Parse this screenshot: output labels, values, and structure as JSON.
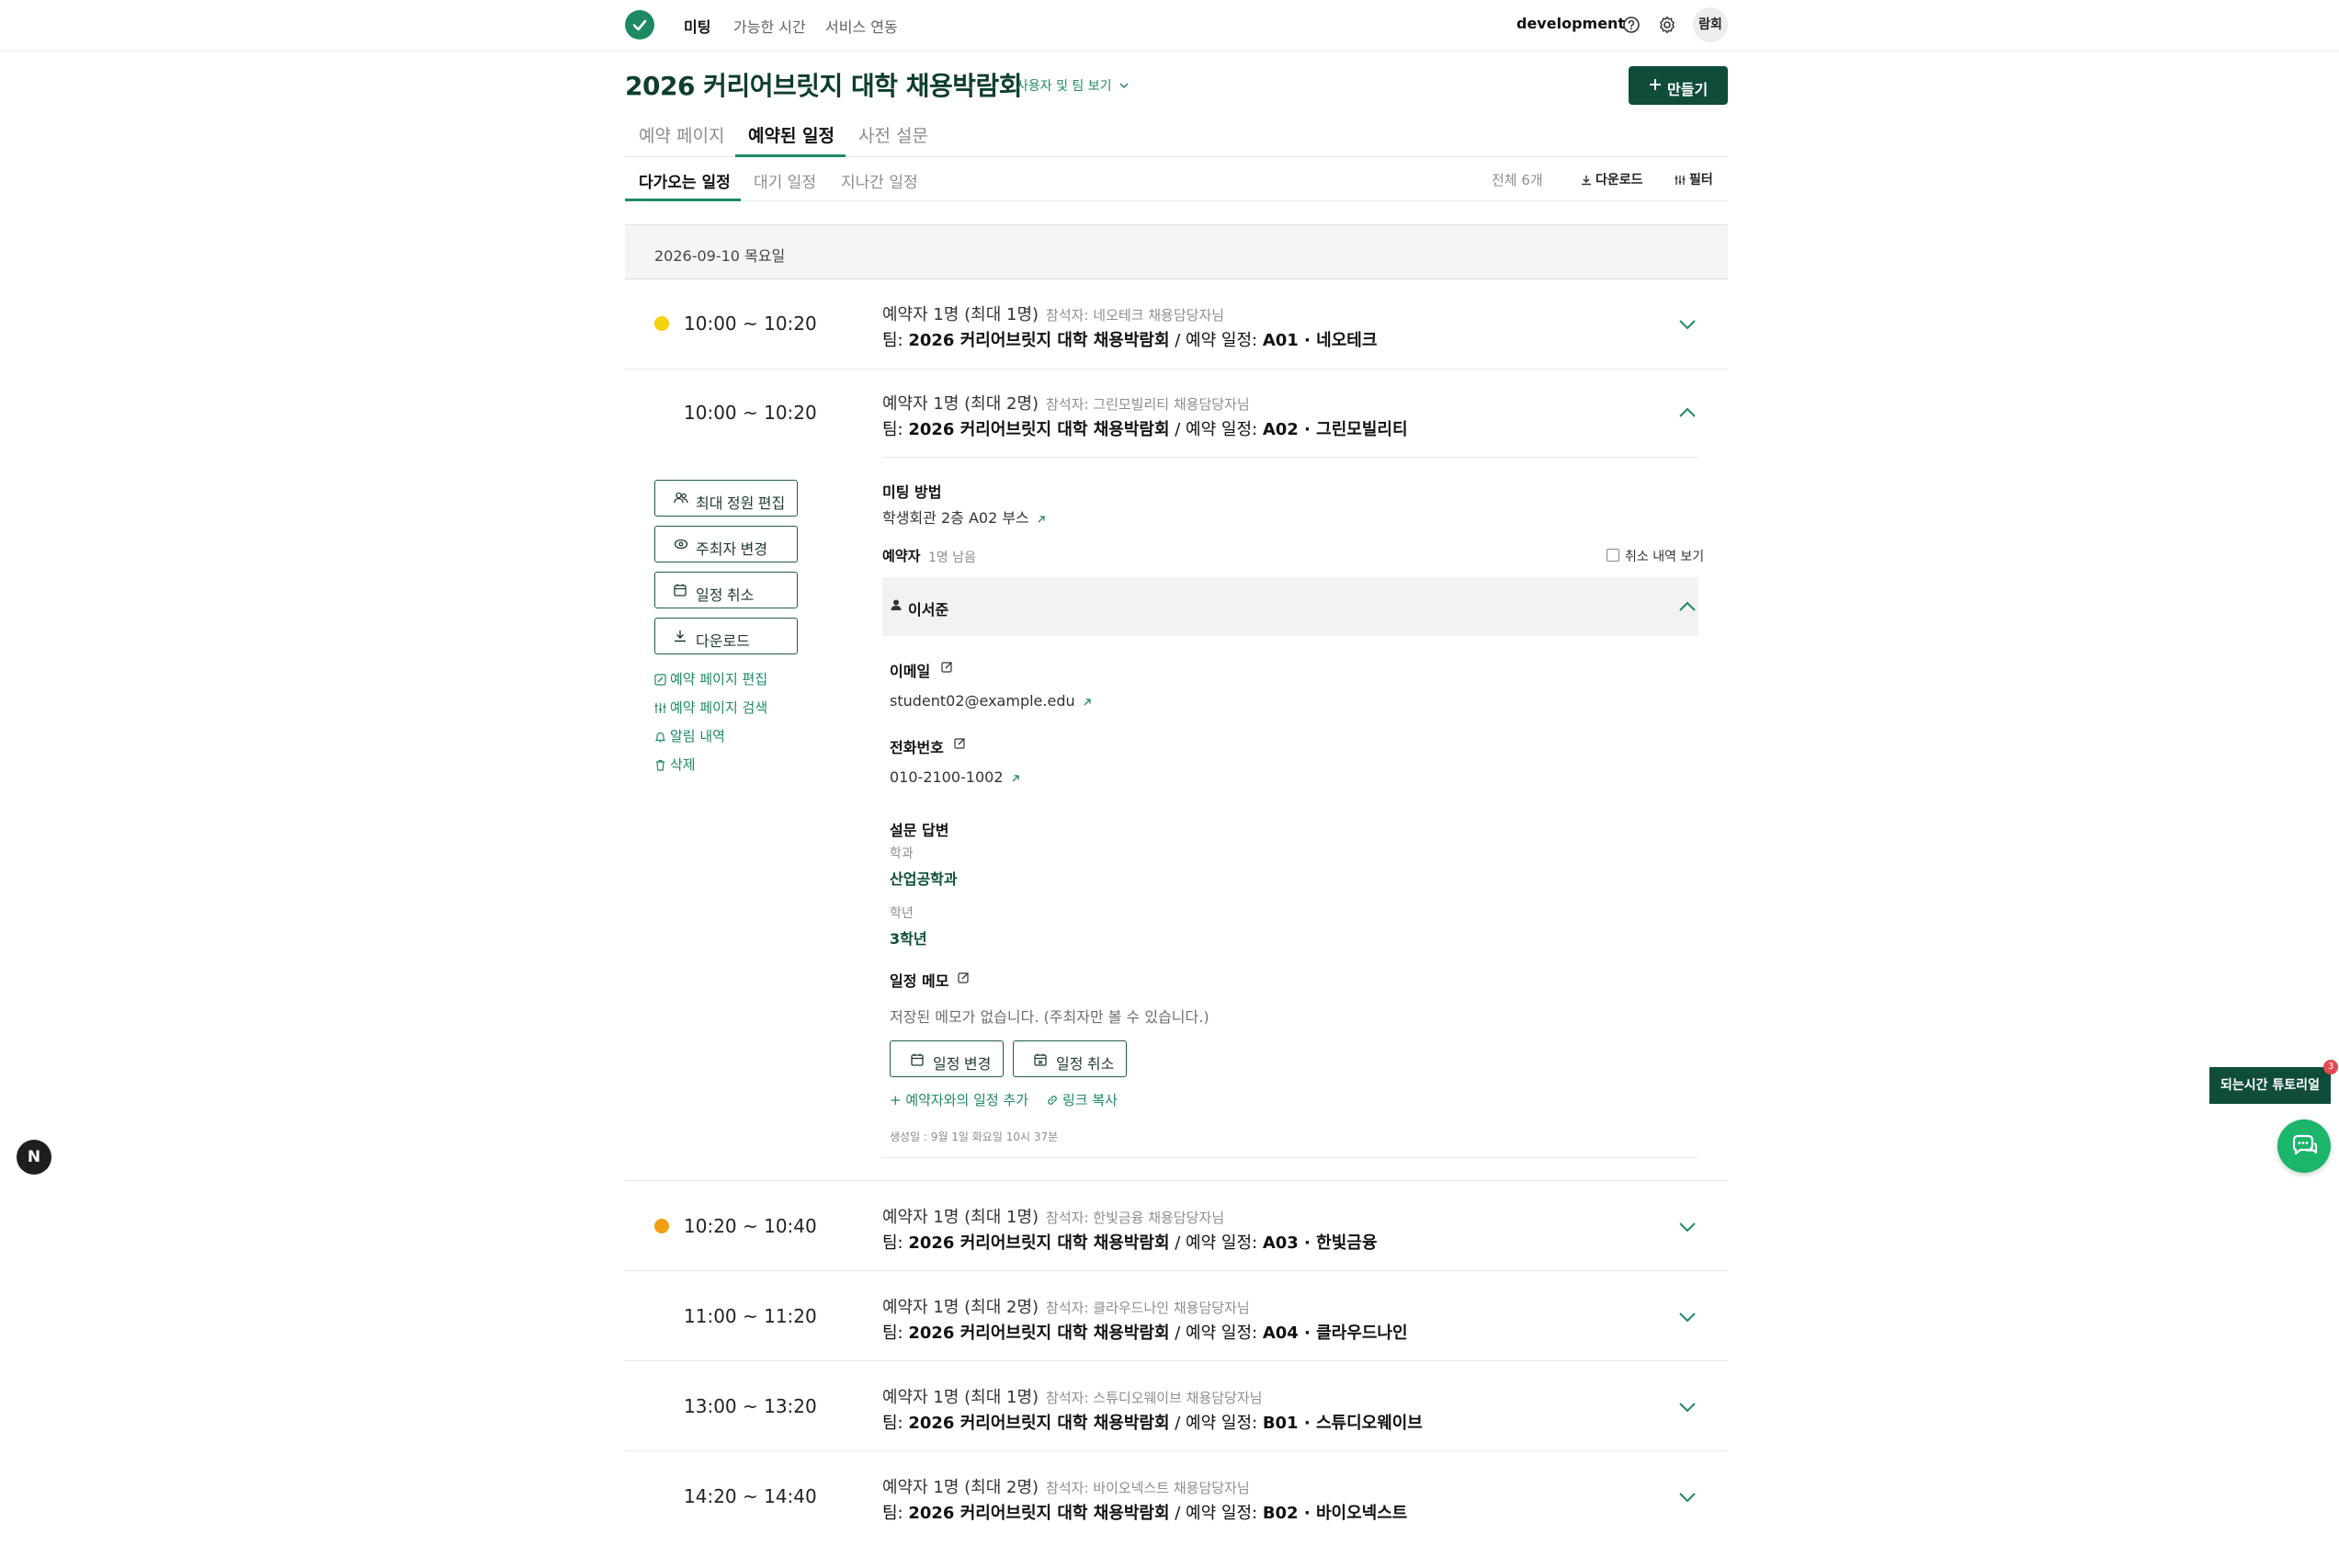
{
  "nav": {
    "items": [
      "미팅",
      "가능한 시간",
      "서비스 연동"
    ],
    "org": "development",
    "avatar": "람회"
  },
  "header": {
    "title": "2026 커리어브릿지 대학 채용박람회",
    "view_users": "사용자 및 팀 보기",
    "create": "만들기"
  },
  "tabs": [
    "예약 페이지",
    "예약된 일정",
    "사전 설문"
  ],
  "subtabs": [
    "다가오는 일정",
    "대기 일정",
    "지나간 일정"
  ],
  "toolbar": {
    "total": "전체 6개",
    "download": "다운로드",
    "filter": "필터"
  },
  "date": "2026-09-10 목요일",
  "colors": {
    "accent": "#1e8a62",
    "brand_dark": "#0f4d3a",
    "yellow_dot": "#f5d20a",
    "orange_dot": "#f29d12"
  },
  "rows": [
    {
      "time": "10:00 ~ 10:20",
      "count": "예약자 1명 (최대 1명)",
      "attendee": "참석자: 네오테크 채용담당자님",
      "team_prefix": "팀: ",
      "team": "2026 커리어브릿지 대학 채용박람회",
      "sep": " / 예약 일정: ",
      "slot": "A01 · 네오테크",
      "dot": "yellow"
    },
    {
      "time": "10:00 ~ 10:20",
      "count": "예약자 1명 (최대 2명)",
      "attendee": "참석자: 그린모빌리티 채용담당자님",
      "team_prefix": "팀: ",
      "team": "2026 커리어브릿지 대학 채용박람회",
      "sep": " / 예약 일정: ",
      "slot": "A02 · 그린모빌리티",
      "dot": "none"
    },
    {
      "time": "10:20 ~ 10:40",
      "count": "예약자 1명 (최대 1명)",
      "attendee": "참석자: 한빛금융 채용담당자님",
      "team_prefix": "팀: ",
      "team": "2026 커리어브릿지 대학 채용박람회",
      "sep": " / 예약 일정: ",
      "slot": "A03 · 한빛금융",
      "dot": "orange"
    },
    {
      "time": "11:00 ~ 11:20",
      "count": "예약자 1명 (최대 2명)",
      "attendee": "참석자: 클라우드나인 채용담당자님",
      "team_prefix": "팀: ",
      "team": "2026 커리어브릿지 대학 채용박람회",
      "sep": " / 예약 일정: ",
      "slot": "A04 · 클라우드나인",
      "dot": "none"
    },
    {
      "time": "13:00 ~ 13:20",
      "count": "예약자 1명 (최대 1명)",
      "attendee": "참석자: 스튜디오웨이브 채용담당자님",
      "team_prefix": "팀: ",
      "team": "2026 커리어브릿지 대학 채용박람회",
      "sep": " / 예약 일정: ",
      "slot": "B01 · 스튜디오웨이브",
      "dot": "none"
    },
    {
      "time": "14:20 ~ 14:40",
      "count": "예약자 1명 (최대 2명)",
      "attendee": "참석자: 바이오넥스트 채용담당자님",
      "team_prefix": "팀: ",
      "team": "2026 커리어브릿지 대학 채용박람회",
      "sep": " / 예약 일정: ",
      "slot": "B02 · 바이오넥스트",
      "dot": "none"
    }
  ],
  "actions": {
    "buttons": [
      "최대 정원 편집",
      "주최자 변경",
      "일정 취소",
      "다운로드"
    ],
    "links": [
      "예약 페이지 편집",
      "예약 페이지 검색",
      "알림 내역",
      "삭제"
    ]
  },
  "detail": {
    "meeting_method_label": "미팅 방법",
    "meeting_method": "학생회관 2층 A02 부스",
    "bookers_label": "예약자",
    "bookers_remaining": "1명 남음",
    "show_cancelled": "취소 내역 보기",
    "booker_name": "이서준",
    "email_label": "이메일",
    "email": "student02@example.edu",
    "phone_label": "전화번호",
    "phone": "010-2100-1002",
    "survey_label": "설문 답변",
    "q1": "학과",
    "a1": "산업공학과",
    "q2": "학년",
    "a2": "3학년",
    "memo_label": "일정 메모",
    "memo": "저장된 메모가 없습니다. (주최자만 볼 수 있습니다.)",
    "reschedule": "일정 변경",
    "cancel": "일정 취소",
    "add_schedule": "+ 예약자와의 일정 추가",
    "copy_link": "링크 복사",
    "created": "생성일 : 9월 1일 화요일 10시 37분"
  },
  "floating": {
    "next": "N",
    "tutorial": "되는시간 튜토리얼",
    "badge": "3"
  }
}
